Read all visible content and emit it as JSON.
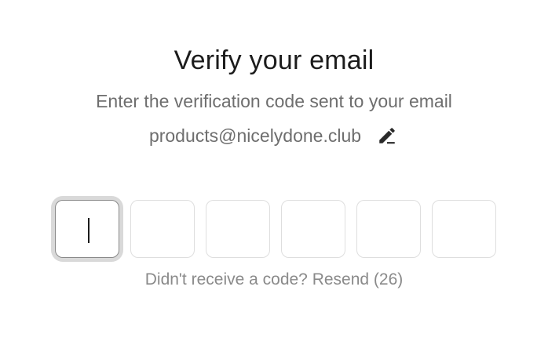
{
  "header": {
    "title": "Verify your email",
    "subtitle": "Enter the verification code sent to your email",
    "email": "products@nicelydone.club",
    "edit_icon": "pencil-edit-icon"
  },
  "code_input": {
    "length": 6,
    "values": [
      "",
      "",
      "",
      "",
      "",
      ""
    ],
    "active_index": 0
  },
  "resend": {
    "text": "Didn't receive a code? Resend (26)"
  },
  "colors": {
    "text_primary": "#1c1c1c",
    "text_secondary": "#6e6e6e",
    "text_muted": "#8a8a8a",
    "box_border": "#dedede",
    "focus_ring": "#d9d9d9"
  }
}
